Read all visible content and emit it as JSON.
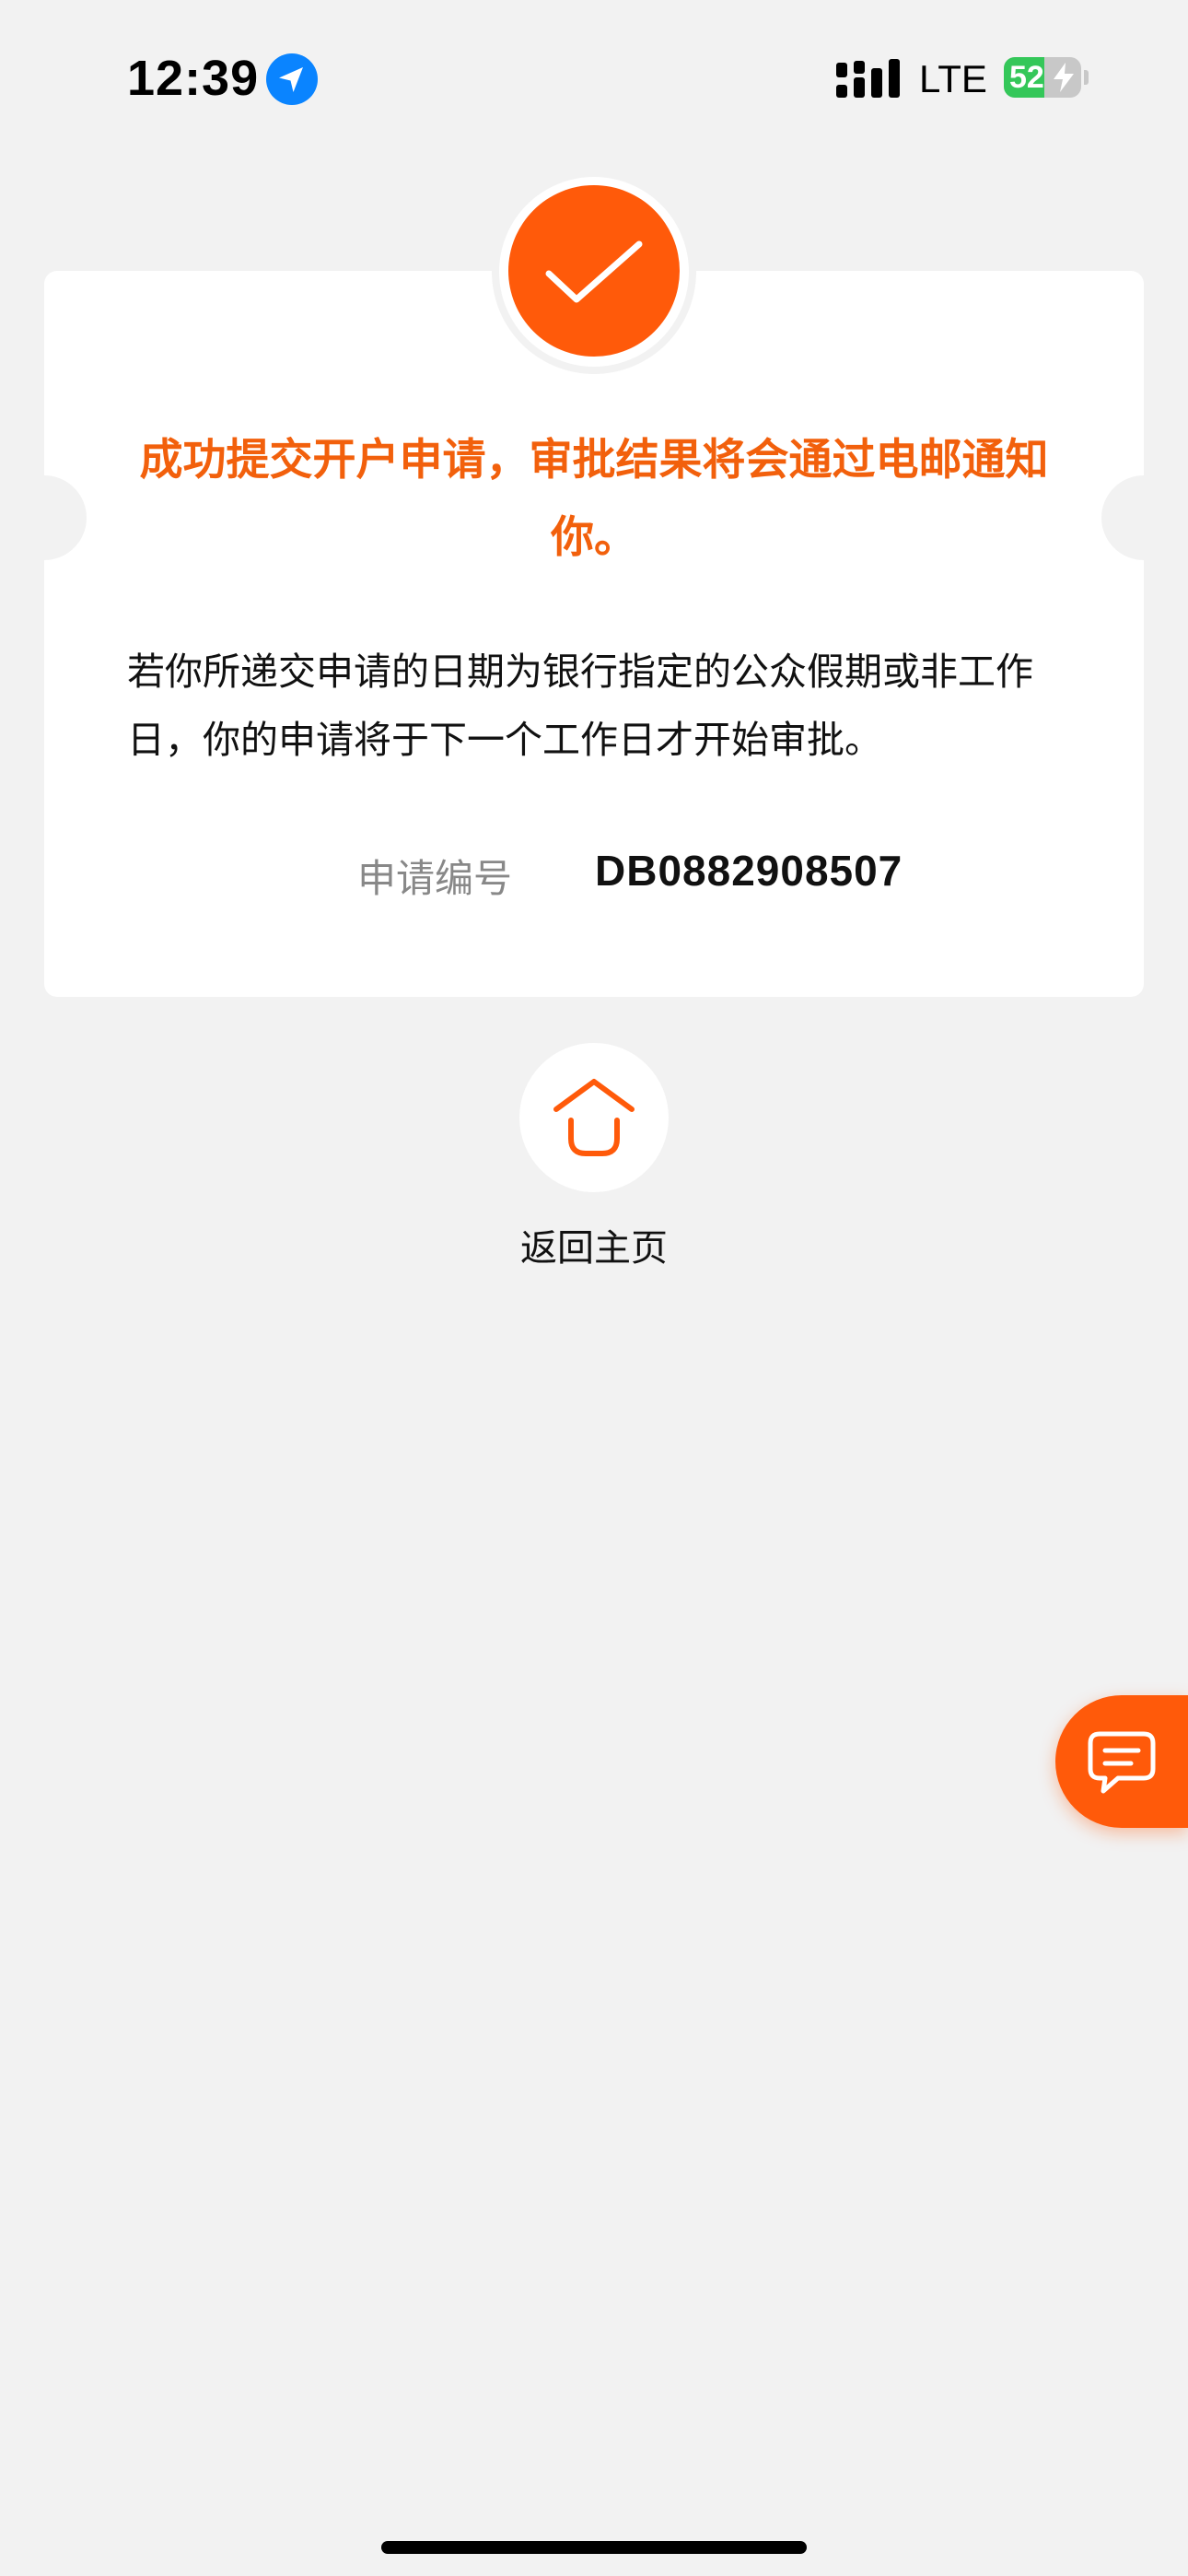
{
  "status_bar": {
    "time": "12:39",
    "network": "LTE",
    "battery_level": "52",
    "battery_fraction": 0.52,
    "battery_color": "#34c759",
    "location_icon": "location-arrow-icon",
    "signal_icon": "cellular-signal-icon",
    "charging_icon": "bolt-icon"
  },
  "result_card": {
    "status_icon": "checkmark-icon",
    "title": "成功提交开户申请，审批结果将会通过电邮通知你。",
    "note": "若你所递交申请的日期为银行指定的公众假期或非工作日，你的申请将于下一个工作日才开始审批。",
    "reference_label": "申请编号",
    "reference_value": "DB0882908507"
  },
  "home_action": {
    "icon": "home-icon",
    "label": "返回主页"
  },
  "chat_button": {
    "icon": "chat-bubble-icon"
  },
  "colors": {
    "accent": "#ff5a0a",
    "title": "#f2600c",
    "background": "#f2f2f2"
  }
}
